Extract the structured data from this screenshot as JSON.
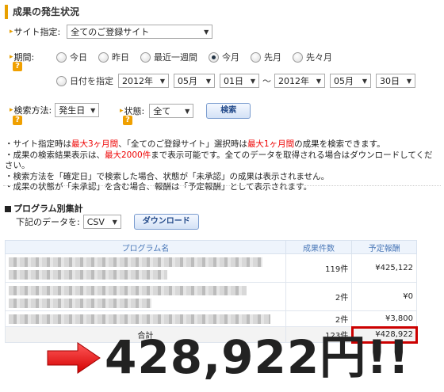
{
  "page_title": "成果の発生状況",
  "site": {
    "label": "サイト指定:",
    "value": "全てのご登録サイト"
  },
  "period": {
    "label": "期間:",
    "options": [
      {
        "label": "今日",
        "selected": false
      },
      {
        "label": "昨日",
        "selected": false
      },
      {
        "label": "最近一週間",
        "selected": false
      },
      {
        "label": "今月",
        "selected": true
      },
      {
        "label": "先月",
        "selected": false
      },
      {
        "label": "先々月",
        "selected": false
      }
    ],
    "custom_label": "日付を指定",
    "from": {
      "year": "2012年",
      "month": "05月",
      "day": "01日"
    },
    "separator": "～",
    "to": {
      "year": "2012年",
      "month": "05月",
      "day": "30日"
    }
  },
  "search": {
    "method_label": "検索方法:",
    "method_value": "発生日",
    "status_label": "状態:",
    "status_value": "全て",
    "button": "検索"
  },
  "help_icon": "?",
  "notes": [
    {
      "parts": [
        {
          "t": "・サイト指定時は"
        },
        {
          "t": "最大3ヶ月間",
          "red": true
        },
        {
          "t": "、「全てのご登録サイト」選択時は"
        },
        {
          "t": "最大1ヶ月間",
          "red": true
        },
        {
          "t": "の成果を検索できます。"
        }
      ]
    },
    {
      "parts": [
        {
          "t": "・成果の検索結果表示は、"
        },
        {
          "t": "最大2000件",
          "red": true
        },
        {
          "t": "まで表示可能です。全てのデータを取得される場合はダウンロードしてください。"
        }
      ]
    },
    {
      "parts": [
        {
          "t": "・検索方法を「確定日」で検索した場合、状態が「未承認」の成果は表示されません。"
        }
      ]
    },
    {
      "parts": [
        {
          "t": "・成果の状態が「未承認」を含む場合、報酬は「予定報酬」として表示されます。"
        }
      ]
    }
  ],
  "program_section": {
    "title": "プログラム別集計",
    "download_label": "下記のデータを:",
    "format": "CSV",
    "download_button": "ダウンロード"
  },
  "table": {
    "headers": [
      "プログラム名",
      "成果件数",
      "予定報酬"
    ],
    "rows": [
      {
        "count": "119件",
        "reward": "¥425,122"
      },
      {
        "count": "2件",
        "reward": "¥0"
      },
      {
        "count": "2件",
        "reward": "¥3,800"
      }
    ],
    "total": {
      "label": "合計",
      "count": "123件",
      "reward": "¥428,922"
    }
  },
  "big_total": "428,922円!!",
  "colors": {
    "accent": "#e8a000",
    "red": "#e00000",
    "highlight_box": "#cc0000"
  },
  "icons": [
    "help-icon",
    "arrow-right-icon",
    "chevron-down-icon"
  ]
}
